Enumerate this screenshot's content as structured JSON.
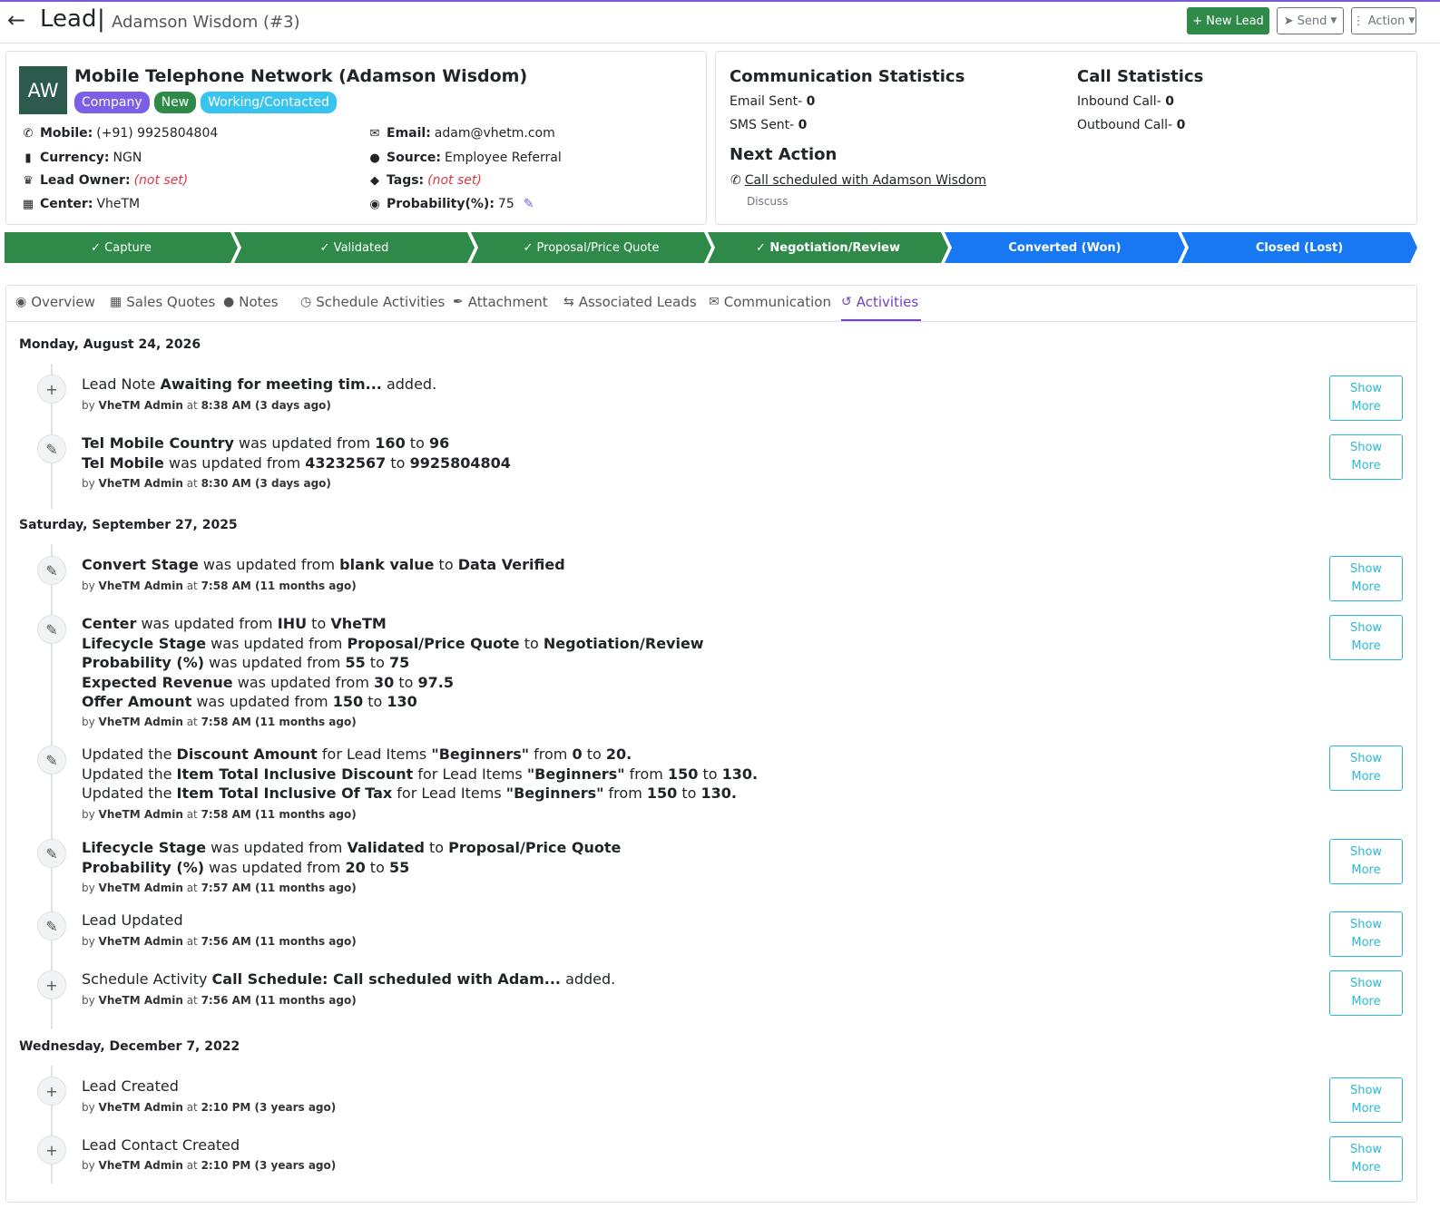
{
  "header": {
    "title": "Lead",
    "separator": "|",
    "subtitle": "Adamson Wisdom (#3)",
    "new_lead_label": "New Lead",
    "send_label": "Send",
    "action_label": "Action"
  },
  "lead": {
    "initials": "AW",
    "company_name": "Mobile Telephone Network (Adamson Wisdom)",
    "badges": [
      "Company",
      "New",
      "Working/Contacted"
    ],
    "mobile_label": "Mobile:",
    "mobile": "(+91) 9925804804",
    "currency_label": "Currency:",
    "currency": "NGN",
    "owner_label": "Lead Owner:",
    "owner": "(not set)",
    "center_label": "Center:",
    "center": "VheTM",
    "email_label": "Email:",
    "email": "adam@vhetm.com",
    "source_label": "Source:",
    "source": "Employee Referral",
    "tags_label": "Tags:",
    "tags": "(not set)",
    "probability_label": "Probability(%):",
    "probability": "75"
  },
  "stats": {
    "comm_title": "Communication Statistics",
    "email_sent_label": "Email Sent-",
    "email_sent": "0",
    "sms_sent_label": "SMS Sent-",
    "sms_sent": "0",
    "call_title": "Call Statistics",
    "inbound_label": "Inbound Call-",
    "inbound": "0",
    "outbound_label": "Outbound Call-",
    "outbound": "0",
    "next_action_title": "Next Action",
    "next_action_link": "Call scheduled with Adamson Wisdom",
    "next_action_sub": "Discuss"
  },
  "pipeline": {
    "stages": [
      {
        "label": "✓ Capture",
        "status": "done"
      },
      {
        "label": "✓ Validated",
        "status": "done"
      },
      {
        "label": "✓ Proposal/Price Quote",
        "status": "done"
      },
      {
        "label": "✓ Negotiation/Review",
        "status": "current"
      },
      {
        "label": "Converted (Won)",
        "status": "todo"
      },
      {
        "label": "Closed (Lost)",
        "status": "todo"
      }
    ]
  },
  "tabs": [
    "Overview",
    "Sales Quotes",
    "Notes",
    "Schedule Activities",
    "Attachment",
    "Associated Leads",
    "Communication",
    "Activities"
  ],
  "activities": {
    "show_label_1": "Show",
    "show_label_2": "More",
    "groups": [
      {
        "date": "Monday, August 24, 2026"
      },
      {
        "date": "Saturday, September 27, 2025"
      },
      {
        "date": "Wednesday, December 7, 2022"
      }
    ],
    "items": [
      {
        "meta_user": "VheTM Admin",
        "meta_time": "8:38 AM (3 days ago)"
      },
      {
        "meta_user": "VheTM Admin",
        "meta_time": "8:30 AM (3 days ago)"
      },
      {
        "meta_user": "VheTM Admin",
        "meta_time": "7:58 AM (11 months ago)"
      },
      {
        "meta_user": "VheTM Admin",
        "meta_time": "7:58 AM (11 months ago)"
      },
      {
        "meta_user": "VheTM Admin",
        "meta_time": "7:58 AM (11 months ago)"
      },
      {
        "meta_user": "VheTM Admin",
        "meta_time": "7:57 AM (11 months ago)"
      },
      {
        "meta_user": "VheTM Admin",
        "meta_time": "7:56 AM (11 months ago)"
      },
      {
        "meta_user": "VheTM Admin",
        "meta_time": "7:56 AM (11 months ago)"
      },
      {
        "meta_user": "VheTM Admin",
        "meta_time": "2:10 PM (3 years ago)"
      },
      {
        "meta_user": "VheTM Admin",
        "meta_time": "2:10 PM (3 years ago)"
      }
    ],
    "by": "by",
    "at": "at",
    "t": {
      "lead_note": "Lead Note",
      "awaiting": "Awaiting for meeting tim...",
      "added": "added.",
      "tel_mobile_country": "Tel Mobile Country",
      "was_updated_from": "was updated from",
      "to": "to",
      "v160": "160",
      "v96": "96",
      "tel_mobile": "Tel Mobile",
      "v43232567": "43232567",
      "v9925804804": "9925804804",
      "convert_stage": "Convert Stage",
      "blank_value": "blank value",
      "data_verified": "Data Verified",
      "center": "Center",
      "ihu": "IHU",
      "vhetm": "VheTM",
      "lifecycle_stage": "Lifecycle Stage",
      "proposal": "Proposal/Price Quote",
      "negotiation": "Negotiation/Review",
      "probability": "Probability (%)",
      "v55": "55",
      "v75": "75",
      "expected_revenue": "Expected Revenue",
      "v30": "30",
      "v97_5": "97.5",
      "offer_amount": "Offer Amount",
      "v150": "150",
      "v130": "130",
      "updated_the": "Updated the",
      "discount_amount": "Discount Amount",
      "for_lead_items": "for Lead Items",
      "beginners": "\"Beginners\"",
      "from": "from",
      "v0": "0",
      "v20_dot": "20.",
      "v130_dot": "130.",
      "item_total_incl_discount": "Item Total Inclusive Discount",
      "item_total_incl_tax": "Item Total Inclusive Of Tax",
      "validated": "Validated",
      "v20": "20",
      "lead_updated": "Lead Updated",
      "schedule_activity": "Schedule Activity",
      "call_schedule": "Call Schedule: Call scheduled with Adam...",
      "lead_created": "Lead Created",
      "lead_contact_created": "Lead Contact Created"
    }
  }
}
